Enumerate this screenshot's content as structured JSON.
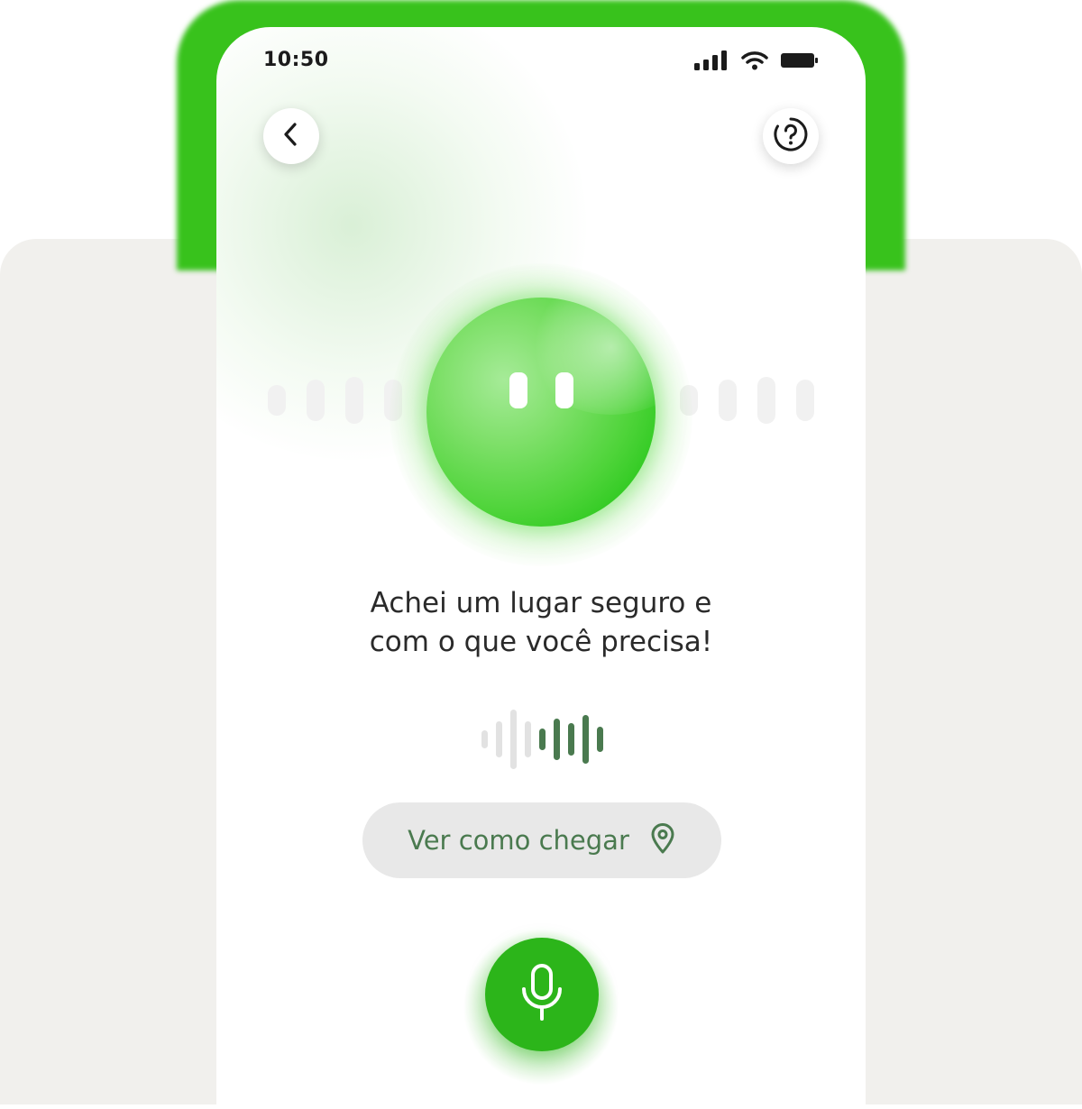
{
  "status_bar": {
    "time": "10:50",
    "icons": [
      "signal-icon",
      "wifi-icon",
      "battery-icon"
    ]
  },
  "header": {
    "back_icon": "chevron-left-icon",
    "help_icon": "question-circle-icon"
  },
  "assistant": {
    "message": "Achei um lugar seguro e\ncom o que você precisa!"
  },
  "action": {
    "label": "Ver como chegar",
    "icon": "map-pin-icon"
  },
  "mic": {
    "icon": "microphone-icon"
  },
  "colors": {
    "brand_green": "#2cb51a",
    "frame_green": "#38c21c",
    "button_text": "#4a7a4f",
    "voice_active": "#4a7a4f",
    "voice_inactive": "#e2e2e2",
    "backdrop": "#f1f0ed"
  }
}
